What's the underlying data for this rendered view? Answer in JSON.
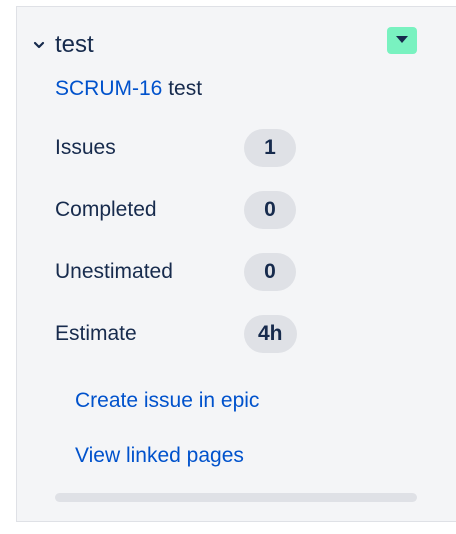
{
  "epic": {
    "title": "test",
    "key": "SCRUM-16",
    "summary": "test",
    "color": "#79f2c0"
  },
  "stats": [
    {
      "label": "Issues",
      "value": "1"
    },
    {
      "label": "Completed",
      "value": "0"
    },
    {
      "label": "Unestimated",
      "value": "0"
    },
    {
      "label": "Estimate",
      "value": "4h"
    }
  ],
  "actions": {
    "create_issue": "Create issue in epic",
    "view_linked": "View linked pages"
  },
  "progress": {
    "completed_fraction": 0
  },
  "icons": {
    "collapse": "chevron-down-icon",
    "color_menu": "caret-down-icon"
  }
}
